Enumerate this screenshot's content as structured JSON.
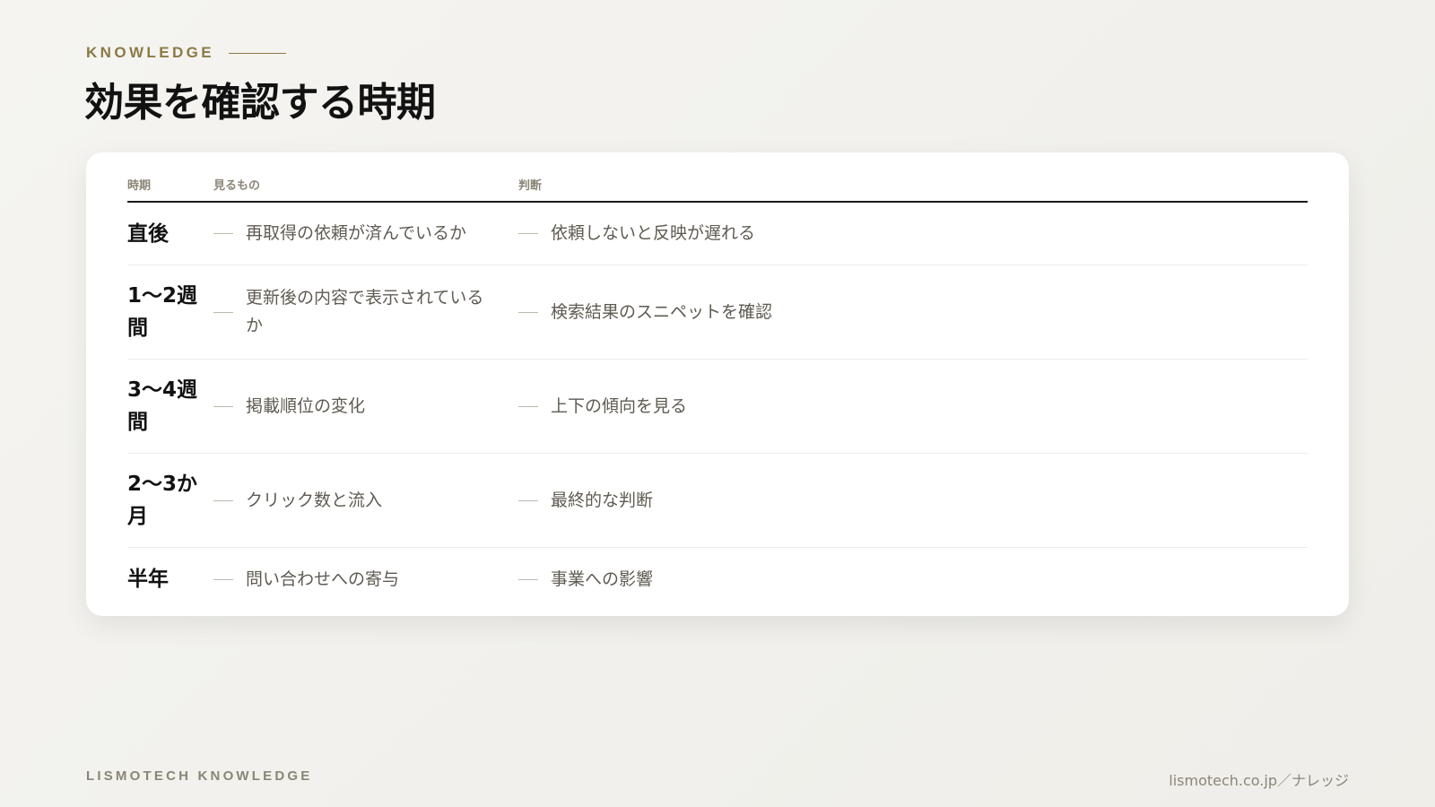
{
  "eyebrow": "KNOWLEDGE",
  "title": "効果を確認する時期",
  "table": {
    "headers": {
      "period": "時期",
      "observe": "見るもの",
      "judge": "判断"
    },
    "rows": [
      {
        "period": "直後",
        "observe": "再取得の依頼が済んでいるか",
        "judge": "依頼しないと反映が遅れる"
      },
      {
        "period": "1〜2週間",
        "observe": "更新後の内容で表示されているか",
        "judge": "検索結果のスニペットを確認"
      },
      {
        "period": "3〜4週間",
        "observe": "掲載順位の変化",
        "judge": "上下の傾向を見る"
      },
      {
        "period": "2〜3か月",
        "observe": "クリック数と流入",
        "judge": "最終的な判断"
      },
      {
        "period": "半年",
        "observe": "問い合わせへの寄与",
        "judge": "事業への影響"
      }
    ]
  },
  "footer": {
    "brand": "LISMOTECH KNOWLEDGE",
    "url": "lismotech.co.jp／ナレッジ"
  },
  "colors": {
    "accent": "#8c7a45",
    "background": "#f3f2ee",
    "card": "#ffffff",
    "text": "#121212",
    "muted": "#5f5b52"
  }
}
